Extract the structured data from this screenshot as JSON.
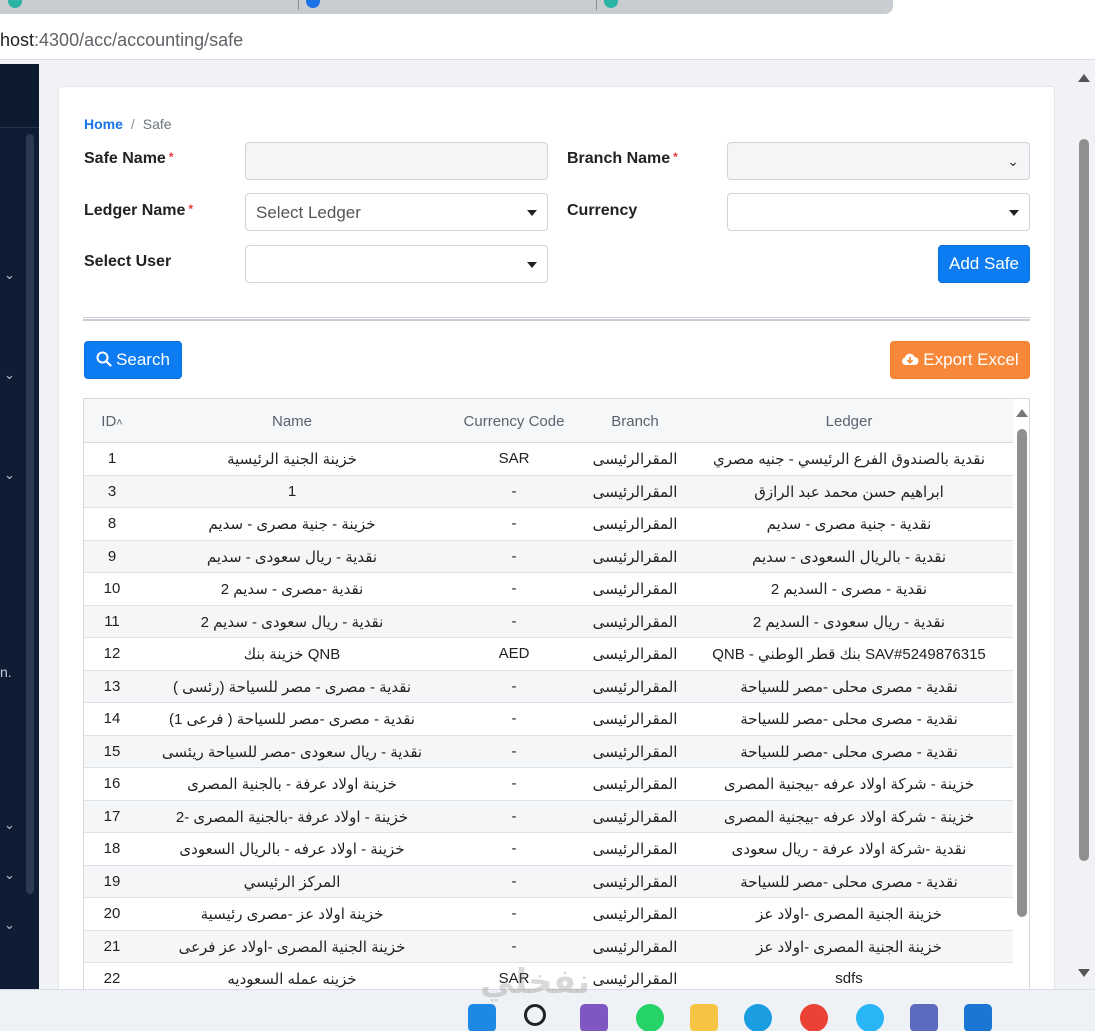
{
  "browser": {
    "url_host": "host",
    "url_path": ":4300/acc/accounting/safe"
  },
  "breadcrumb": {
    "home": "Home",
    "separator": "/",
    "current": "Safe"
  },
  "form": {
    "safe_name_label": "Safe Name",
    "branch_name_label": "Branch Name",
    "ledger_name_label": "Ledger Name",
    "currency_label": "Currency",
    "select_user_label": "Select User",
    "required_mark": "*",
    "ledger_placeholder": "Select Ledger",
    "add_safe_label": "Add Safe"
  },
  "toolbar": {
    "search_label": "Search",
    "export_label": "Export Excel"
  },
  "table": {
    "columns": [
      "ID",
      "Name",
      "Currency Code",
      "Branch",
      "Ledger"
    ],
    "rows": [
      {
        "id": "1",
        "name": "خزينة الجنية الرئيسية",
        "currency": "SAR",
        "branch": "المقرالرئيسى",
        "ledger": "نقدية بالصندوق الفرع الرئيسي - جنيه مصري"
      },
      {
        "id": "3",
        "name": "1",
        "currency": "-",
        "branch": "المقرالرئيسى",
        "ledger": "ابراهيم حسن محمد عبد الرازق"
      },
      {
        "id": "8",
        "name": "خزينة - جنية مصرى - سديم",
        "currency": "-",
        "branch": "المقرالرئيسى",
        "ledger": "نقدية - جنية مصرى - سديم"
      },
      {
        "id": "9",
        "name": "نقدية - ريال سعودى - سديم",
        "currency": "-",
        "branch": "المقرالرئيسى",
        "ledger": "نقدية - بالريال السعودى - سديم"
      },
      {
        "id": "10",
        "name": "نقدية -مصرى - سديم 2",
        "currency": "-",
        "branch": "المقرالرئيسى",
        "ledger": "نقدية - مصرى - السديم 2"
      },
      {
        "id": "11",
        "name": "نقدية - ريال سعودى - سديم 2",
        "currency": "-",
        "branch": "المقرالرئيسى",
        "ledger": "نقدية - ريال سعودى - السديم 2"
      },
      {
        "id": "12",
        "name": "خزينة بنك QNB",
        "currency": "AED",
        "branch": "المقرالرئيسى",
        "ledger": "QNB - بنك قطر الوطني SAV#5249876315"
      },
      {
        "id": "13",
        "name": "نقدية - مصرى - مصر للسياحة (رئسى )",
        "currency": "-",
        "branch": "المقرالرئيسى",
        "ledger": "نقدية - مصرى محلى -مصر للسياحة"
      },
      {
        "id": "14",
        "name": "نقدية - مصرى -مصر للسياحة ( فرعى 1)",
        "currency": "-",
        "branch": "المقرالرئيسى",
        "ledger": "نقدية - مصرى محلى -مصر للسياحة"
      },
      {
        "id": "15",
        "name": "نقدية - ريال سعودى -مصر للسياحة ريئسى",
        "currency": "-",
        "branch": "المقرالرئيسى",
        "ledger": "نقدية - مصرى محلى -مصر للسياحة"
      },
      {
        "id": "16",
        "name": "خزينة اولاد عرفة - بالجنية المصرى",
        "currency": "-",
        "branch": "المقرالرئيسى",
        "ledger": "خزينة - شركة اولاد عرفه -بيجنية المصرى"
      },
      {
        "id": "17",
        "name": "خزينة - اولاد عرفة -بالجنية المصرى -2",
        "currency": "-",
        "branch": "المقرالرئيسى",
        "ledger": "خزينة - شركة اولاد عرفه -بيجنية المصرى"
      },
      {
        "id": "18",
        "name": "خزينة - اولاد عرفه - بالريال السعودى",
        "currency": "-",
        "branch": "المقرالرئيسى",
        "ledger": "نقدية -شركة اولاد عرفة - ريال سعودى"
      },
      {
        "id": "19",
        "name": "المركز الرئيسي",
        "currency": "-",
        "branch": "المقرالرئيسى",
        "ledger": "نقدية - مصرى محلى -مصر للسياحة"
      },
      {
        "id": "20",
        "name": "خزينة اولاد عز -مصرى رئيسية",
        "currency": "-",
        "branch": "المقرالرئيسى",
        "ledger": "خزينة الجنية المصرى -اولاد عز"
      },
      {
        "id": "21",
        "name": "خزينة الجنية المصرى -اولاد عز فرعى",
        "currency": "-",
        "branch": "المقرالرئيسى",
        "ledger": "خزينة الجنية المصرى -اولاد عز"
      },
      {
        "id": "22",
        "name": "خزينه عمله السعوديه",
        "currency": "SAR",
        "branch": "المقرالرئيسى",
        "ledger": "sdfs"
      }
    ]
  },
  "sidebar": {
    "partial_text": "n."
  },
  "taskbar": {
    "watermark": "نفخلي"
  }
}
